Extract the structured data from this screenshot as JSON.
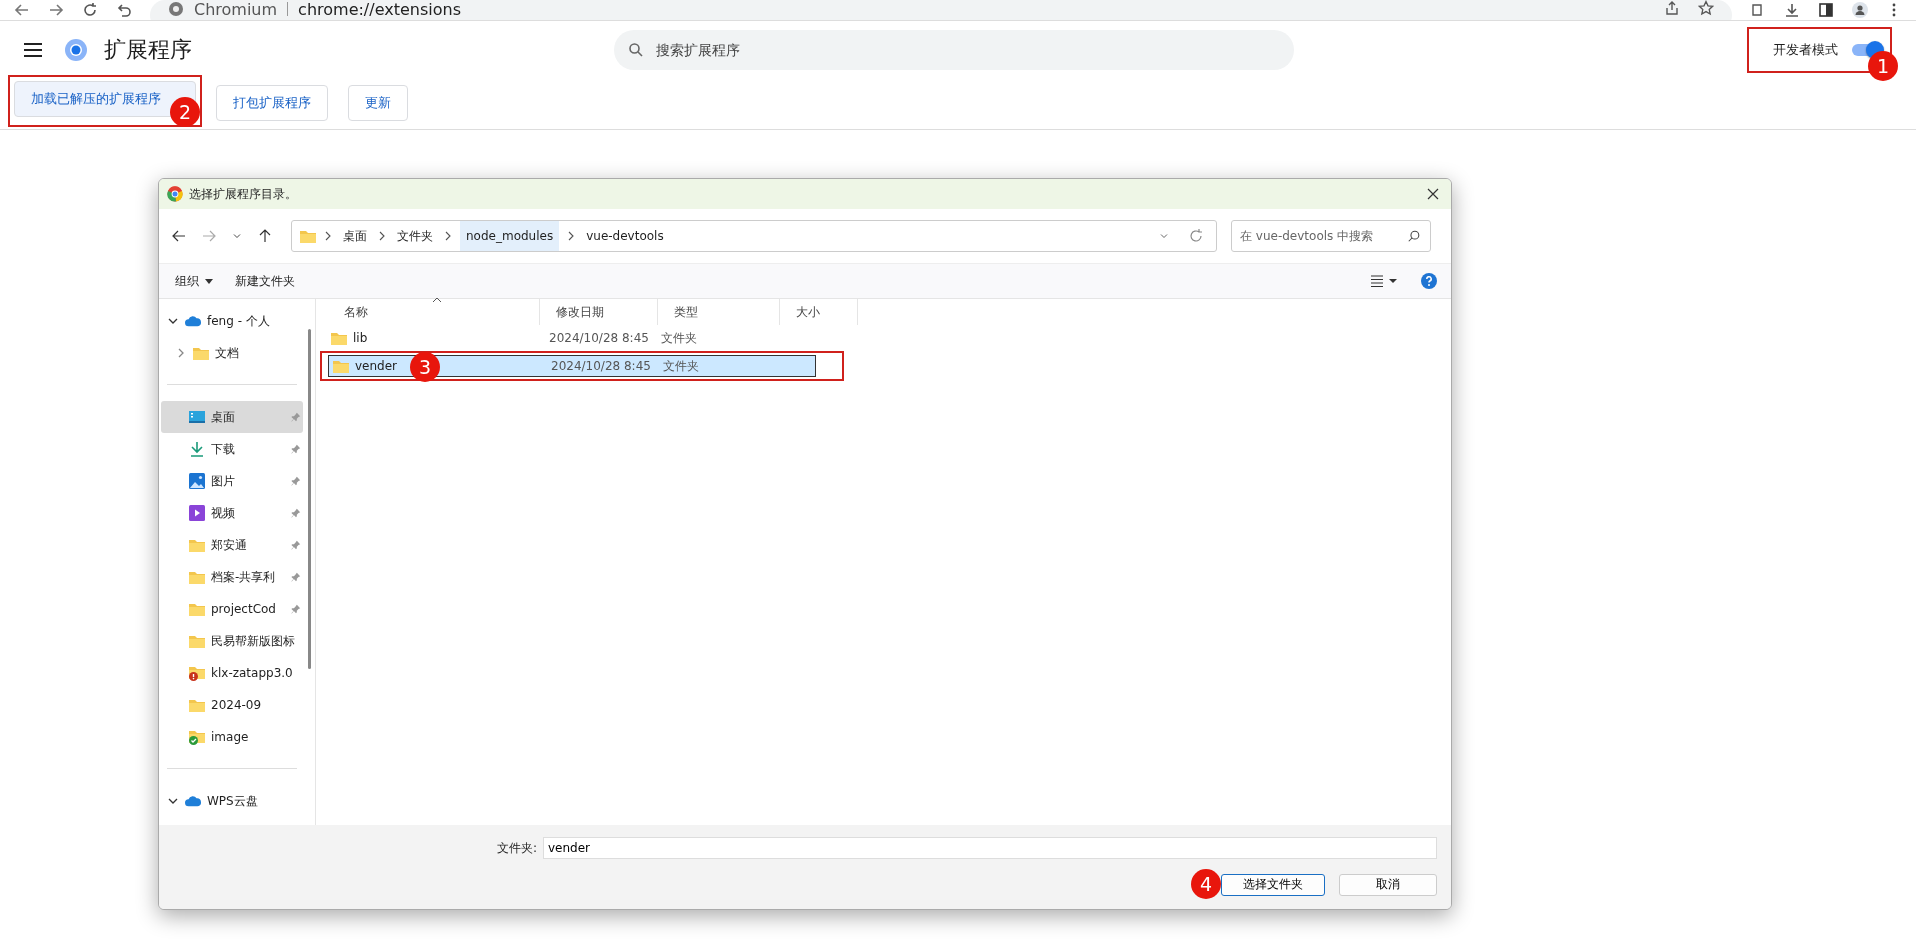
{
  "browser": {
    "site": "Chromium",
    "url": "chrome://extensions"
  },
  "page": {
    "title": "扩展程序",
    "search": {
      "placeholder": "搜索扩展程序"
    },
    "dev_mode": {
      "label": "开发者模式",
      "on": true,
      "badge": "1"
    },
    "buttons": [
      {
        "label": "加载已解压的扩展程序",
        "badge": "2"
      },
      {
        "label": "打包扩展程序"
      },
      {
        "label": "更新"
      }
    ]
  },
  "dialog": {
    "title": "选择扩展程序目录。",
    "breadcrumb": [
      {
        "label": "桌面",
        "selected": false
      },
      {
        "label": "文件夹",
        "selected": false
      },
      {
        "label": "node_modules",
        "selected": true
      },
      {
        "label": "vue-devtools",
        "selected": false
      }
    ],
    "search": {
      "placeholder": "在 vue-devtools 中搜索"
    },
    "toolbar": [
      {
        "label": "组织",
        "menu": true
      },
      {
        "label": "新建文件夹",
        "menu": false
      }
    ],
    "sidebar": [
      {
        "kind": "cloud",
        "label": "feng - 个人",
        "expanded": true,
        "children": [
          {
            "kind": "folder",
            "label": "文档",
            "expanded": false
          }
        ]
      },
      {
        "kind": "divider"
      },
      {
        "kind": "desktop",
        "label": "桌面",
        "pinned": true,
        "selected": true
      },
      {
        "kind": "download",
        "label": "下载",
        "pinned": true,
        "selected": false
      },
      {
        "kind": "pictures",
        "label": "图片",
        "pinned": true,
        "selected": false
      },
      {
        "kind": "video",
        "label": "视频",
        "pinned": true,
        "selected": false
      },
      {
        "kind": "folder",
        "label": "郑安通",
        "pinned": true,
        "selected": false
      },
      {
        "kind": "folder",
        "label": "档案-共享利",
        "pinned": true,
        "selected": false
      },
      {
        "kind": "folder",
        "label": "projectCod",
        "pinned": true,
        "selected": false
      },
      {
        "kind": "folder",
        "label": "民易帮新版图标",
        "pinned": false,
        "selected": false
      },
      {
        "kind": "folder-error",
        "label": "klx-zatapp3.0",
        "pinned": false,
        "selected": false
      },
      {
        "kind": "folder",
        "label": "2024-09",
        "pinned": false,
        "selected": false
      },
      {
        "kind": "folder-ok",
        "label": "image",
        "pinned": false,
        "selected": false
      },
      {
        "kind": "divider"
      },
      {
        "kind": "cloud",
        "label": "WPS云盘",
        "expanded": true
      }
    ],
    "columns": [
      "名称",
      "修改日期",
      "类型",
      "大小"
    ],
    "rows": [
      {
        "name": "lib",
        "modified": "2024/10/28 8:45",
        "type": "文件夹",
        "selected": false
      },
      {
        "name": "vender",
        "modified": "2024/10/28 8:45",
        "type": "文件夹",
        "selected": true,
        "badge": "3"
      }
    ],
    "folder_label": "文件夹:",
    "folder_value": "vender",
    "buttons": [
      {
        "label": "选择文件夹",
        "primary": true,
        "badge": "4"
      },
      {
        "label": "取消",
        "primary": false
      }
    ]
  }
}
